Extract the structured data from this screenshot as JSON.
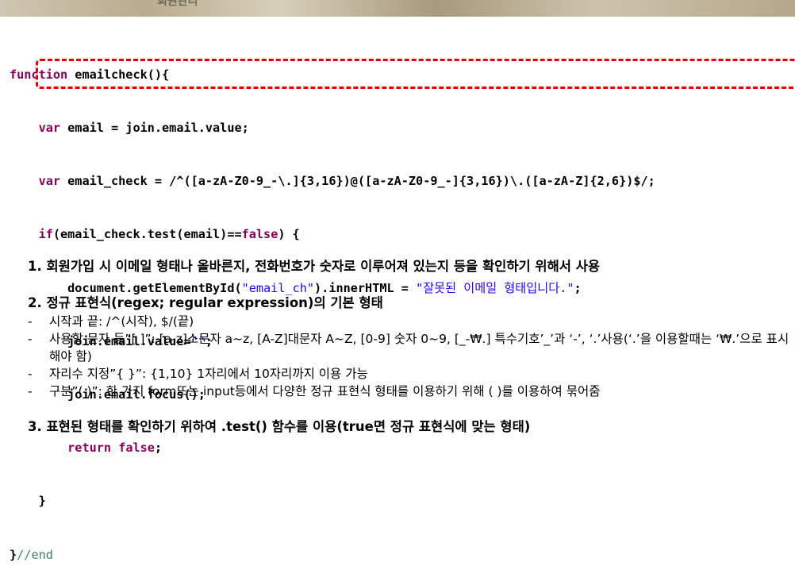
{
  "banner": {
    "title": "회원관리"
  },
  "code": {
    "l1": {
      "kw": "function",
      "rest": " emailcheck(){"
    },
    "l2": {
      "indent": "    ",
      "kw": "var",
      "rest": " email = join.email.value;"
    },
    "l3": {
      "indent": "    ",
      "kw": "var",
      "rest": " email_check = /^([a-zA-Z0-9_-\\.]{3,16})@([a-zA-Z0-9_-]{3,16})\\.([a-zA-Z]{2,6})$/;"
    },
    "l4": {
      "indent": "    ",
      "kw": "if",
      "rest": "(email_check.test(email)==",
      "kw2": "false",
      "rest2": ") {"
    },
    "l5": {
      "indent": "        ",
      "pre": "document.getElementById(",
      "str": "\"email_ch\"",
      "mid": ").innerHTML = ",
      "str2": "\"잘못된 이메일 형태입니다.\"",
      "post": ";"
    },
    "l6": {
      "indent": "        ",
      "pre": "join.email.value=",
      "str": "\"\"",
      "post": ";"
    },
    "l7": {
      "indent": "        ",
      "text": "join.email.focus();"
    },
    "l8": {
      "indent": "        ",
      "kw": "return",
      "mid": " ",
      "kw2": "false",
      "post": ";"
    },
    "l9": {
      "indent": "    ",
      "text": "}"
    },
    "l10": {
      "text": "}",
      "comment": "//end"
    }
  },
  "notes": {
    "h1": "1. 회원가입 시 이메일 형태나 올바른지, 전화번호가 숫자로 이루어져 있는지 등을 확인하기 위해서 사용",
    "h2": "2. 정규 표현식(regex; regular expression)의 기본 형태",
    "bullets": [
      {
        "dash": "-",
        "text": "시작과 끝: /^(시작), $/(끝)"
      },
      {
        "dash": "-",
        "text": "사용할 문자 등”[ ]”: [a-z]소문자 a~z, [A-Z]대문자 A~Z, [0-9] 숫자 0~9, [_-₩.] 특수기호’_’과 ‘-’, ‘.’사용(‘.’을 이용할때는 ‘₩.’으로 표시해야 함)"
      },
      {
        "dash": "-",
        "text": "자리수 지정”{ }”: {1,10} 1자리에서 10자리까지 이용 가능"
      },
      {
        "dash": "-",
        "text": "구분”( )”: 한 가지 form또는 input등에서 다양한 정규 표현식 형태를 이용하기 위해 ( )를 이용하여 묶어줌"
      }
    ],
    "h3": "3. 표현된 형태를 확인하기 위하여 .test() 함수를 이용(true면 정규 표현식에 맞는 형태)"
  }
}
